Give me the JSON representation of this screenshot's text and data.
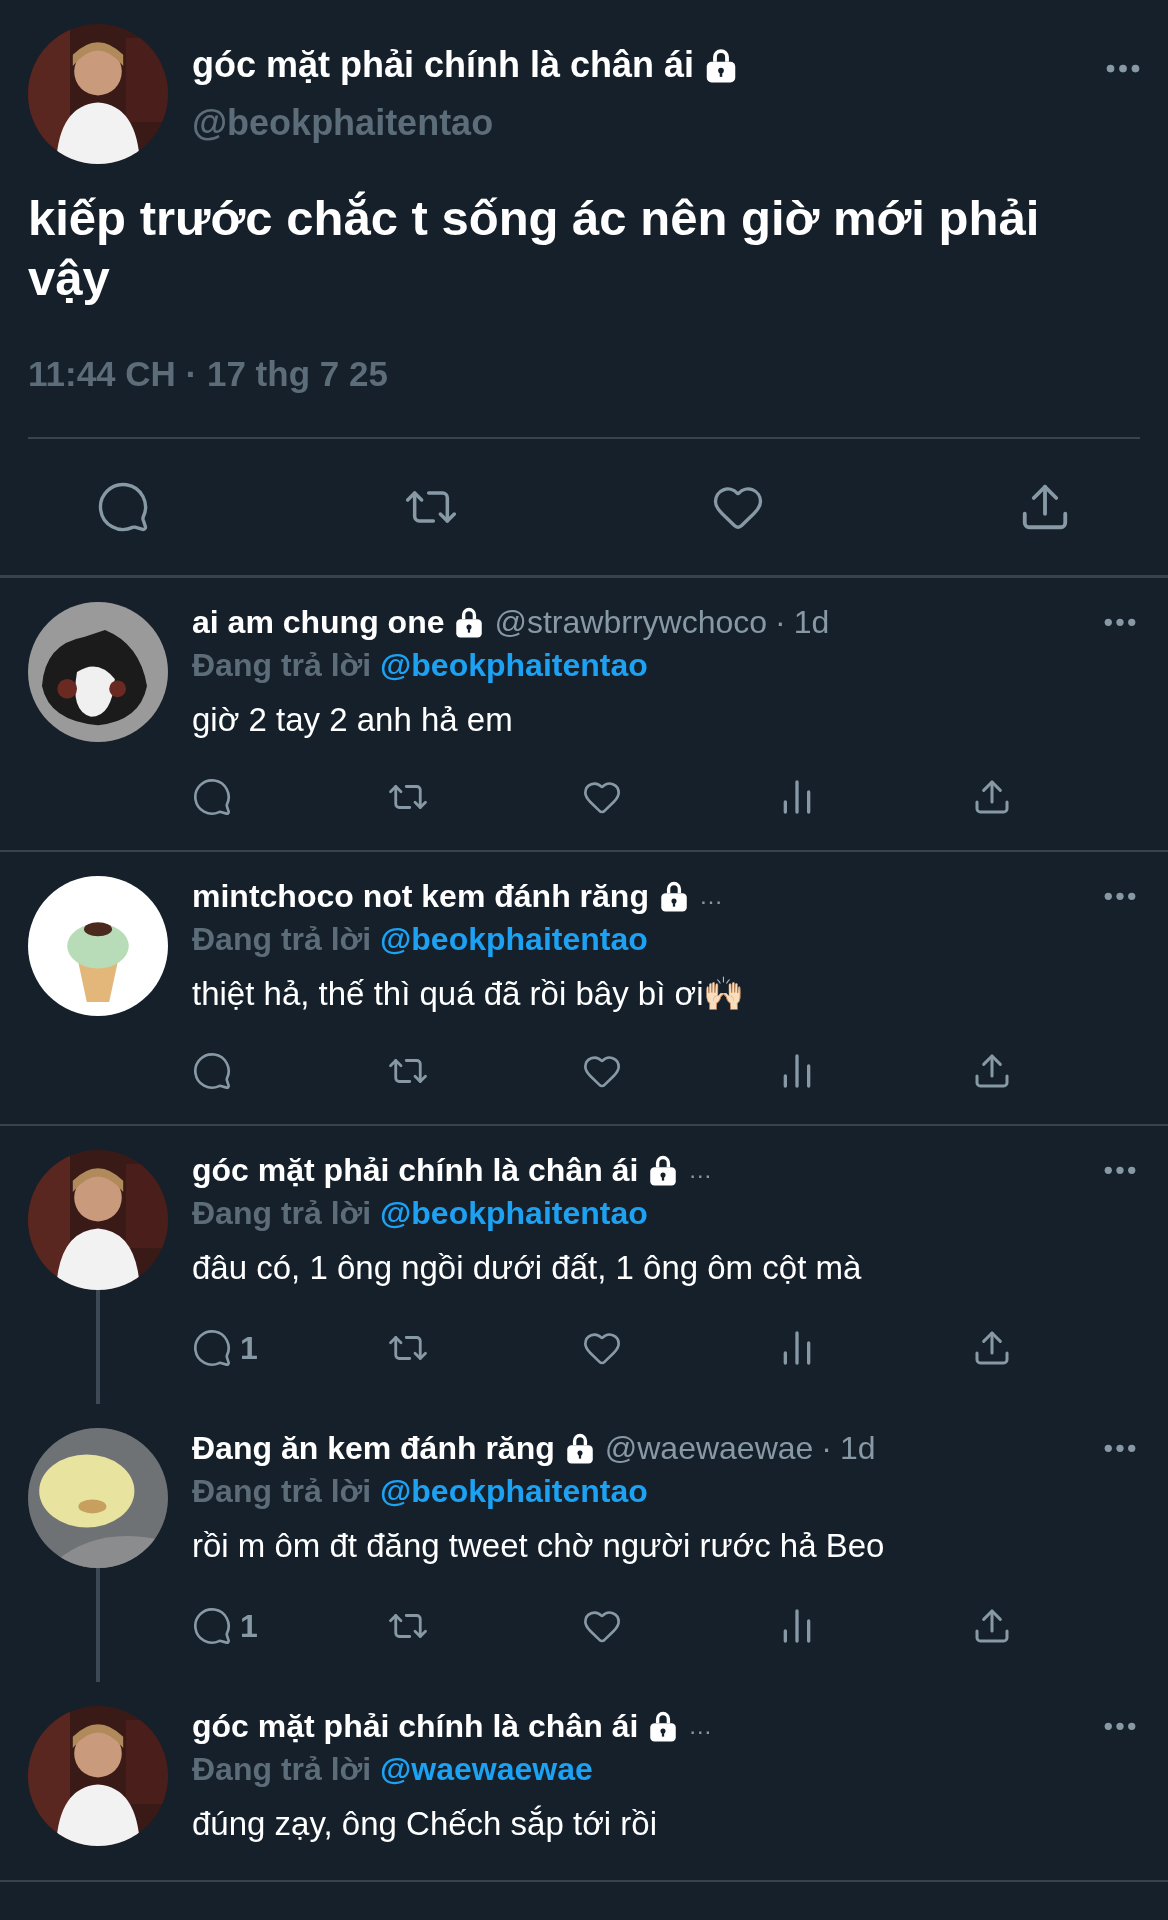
{
  "tweet": {
    "name": "góc mặt phải chính là chân ái",
    "locked": true,
    "handle": "@beokphaitentao",
    "text": "kiếp trước chắc t sống ác nên giờ mới phải vậy",
    "timestamp": "11:44 CH · 17 thg 7 25"
  },
  "replies": [
    {
      "name": "ai am chung one",
      "locked": true,
      "handle": "@strawbrrywchoco",
      "separator": "·",
      "time": "1d",
      "replying_label": "Đang trả lời",
      "replying_to": "@beokphaitentao",
      "text": "giờ 2 tay 2 anh hả em",
      "show_actions": true,
      "thread_line": false
    },
    {
      "name": "mintchoco not kem đánh răng",
      "locked": true,
      "name_cut": "…",
      "replying_label": "Đang trả lời",
      "replying_to": "@beokphaitentao",
      "text": "thiệt hả, thế thì quá đã rồi bây bì ơi🙌🏻",
      "show_actions": true,
      "thread_line": false
    },
    {
      "name": "góc mặt phải chính là chân ái",
      "locked": true,
      "name_cut": "…",
      "replying_label": "Đang trả lời",
      "replying_to": "@beokphaitentao",
      "text": "đâu có, 1 ông ngồi dưới đất, 1 ông ôm cột mà",
      "reply_count": "1",
      "show_actions": true,
      "thread_line": true
    },
    {
      "name": "Đang ăn kem đánh răng",
      "locked": true,
      "handle": "@waewaewae",
      "separator": "·",
      "time": "1d",
      "replying_label": "Đang trả lời",
      "replying_to": "@beokphaitentao",
      "text": "rồi m ôm đt đăng tweet chờ người rước hả Beo",
      "reply_count": "1",
      "show_actions": true,
      "thread_line": true
    },
    {
      "name": "góc mặt phải chính là chân ái",
      "locked": true,
      "name_cut": "…",
      "replying_label": "Đang trả lời",
      "replying_to": "@waewaewae",
      "text": "đúng zạy, ông Chếch sắp tới rồi",
      "show_actions": false,
      "thread_line": false
    }
  ]
}
